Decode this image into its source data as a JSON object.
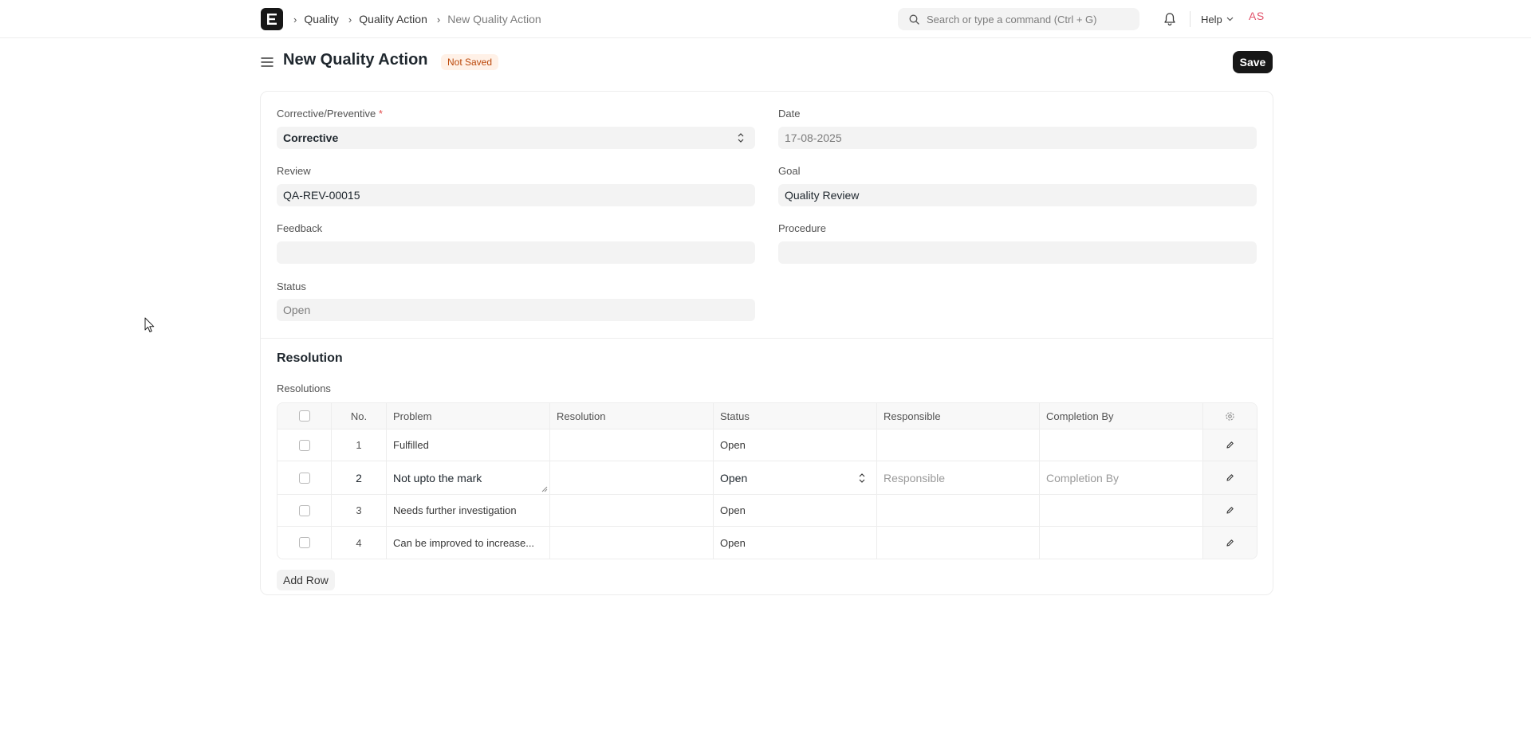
{
  "navbar": {
    "breadcrumbs": [
      "Quality",
      "Quality Action",
      "New Quality Action"
    ],
    "search_placeholder": "Search or type a command (Ctrl + G)",
    "help_label": "Help",
    "avatar_initials": "AS"
  },
  "page": {
    "title": "New Quality Action",
    "status_badge": "Not Saved",
    "save_label": "Save"
  },
  "form": {
    "corrective_preventive": {
      "label": "Corrective/Preventive",
      "required_mark": "*",
      "value": "Corrective"
    },
    "date": {
      "label": "Date",
      "placeholder": "17-08-2025"
    },
    "review": {
      "label": "Review",
      "value": "QA-REV-00015"
    },
    "goal": {
      "label": "Goal",
      "value": "Quality Review"
    },
    "feedback": {
      "label": "Feedback",
      "value": ""
    },
    "procedure": {
      "label": "Procedure",
      "value": ""
    },
    "status": {
      "label": "Status",
      "value": "Open"
    }
  },
  "resolution_section": {
    "title": "Resolution",
    "table_label": "Resolutions",
    "columns": [
      "No.",
      "Problem",
      "Resolution",
      "Status",
      "Responsible",
      "Completion By"
    ],
    "rows": [
      {
        "no": "1",
        "problem": "Fulfilled",
        "resolution": "",
        "status": "Open",
        "responsible": "",
        "completion_by": ""
      },
      {
        "no": "2",
        "problem": "Not upto the mark",
        "resolution": "",
        "status": "Open",
        "responsible": "Responsible",
        "completion_by": "Completion By"
      },
      {
        "no": "3",
        "problem": "Needs further investigation",
        "resolution": "",
        "status": "Open",
        "responsible": "",
        "completion_by": ""
      },
      {
        "no": "4",
        "problem": "Can be improved to increase...",
        "resolution": "",
        "status": "Open",
        "responsible": "",
        "completion_by": ""
      }
    ],
    "add_row_label": "Add Row"
  }
}
